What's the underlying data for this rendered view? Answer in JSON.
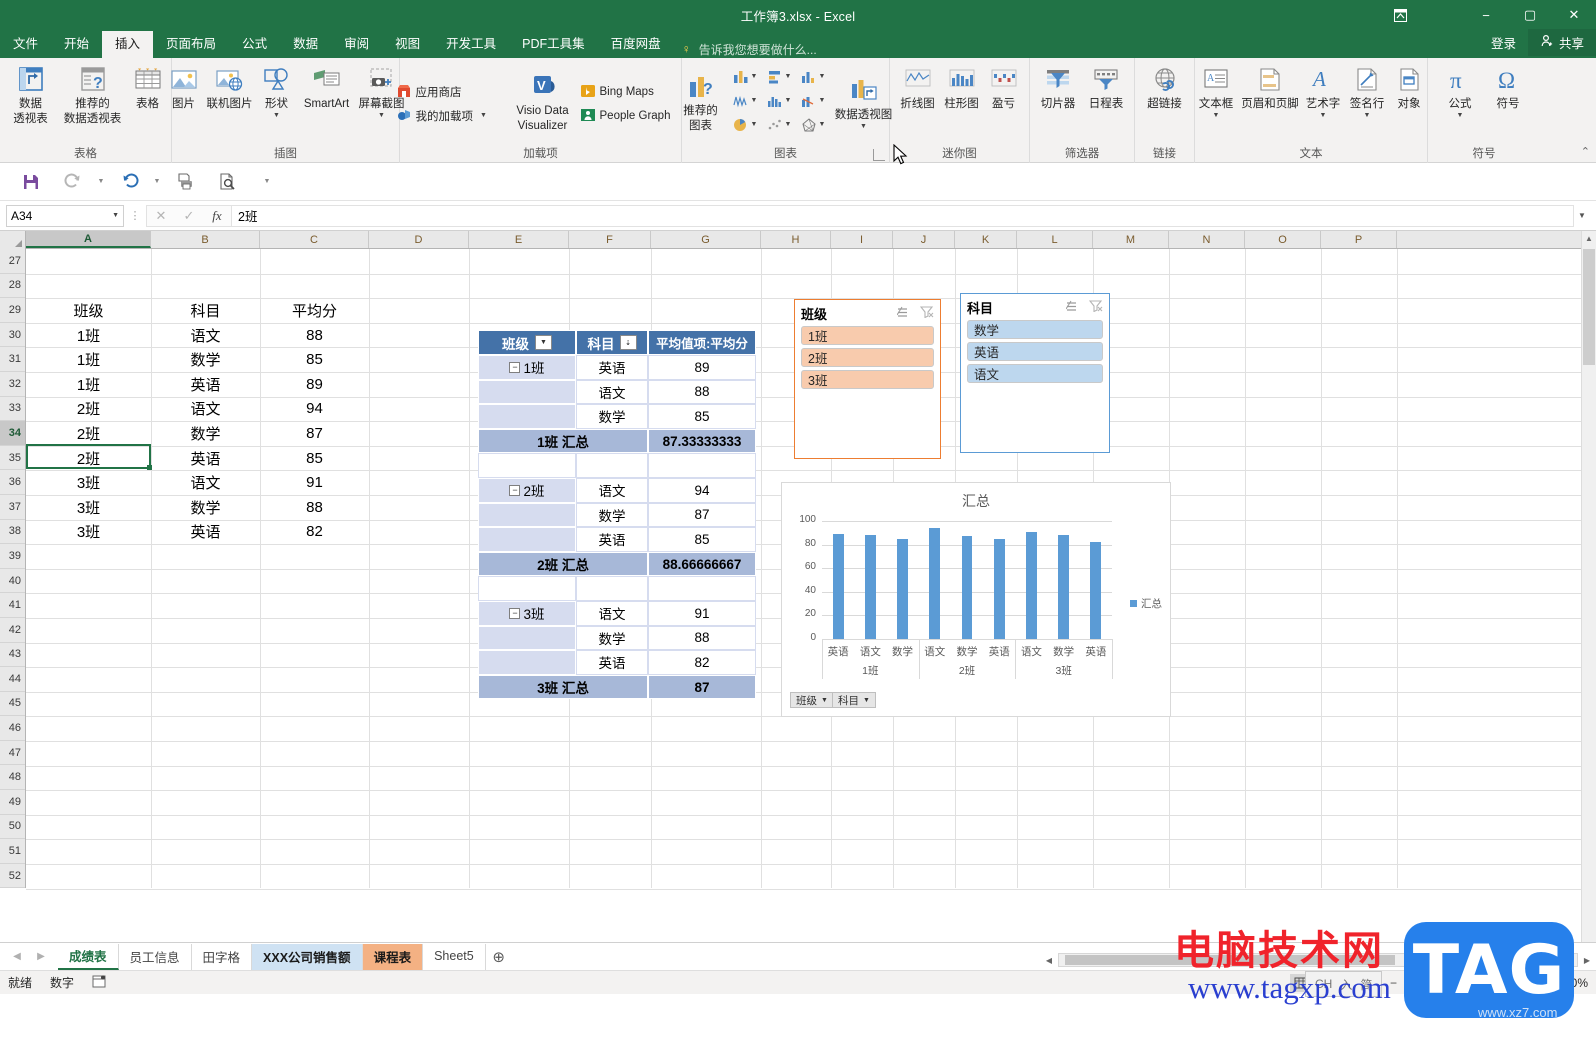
{
  "window": {
    "title": "工作簿3.xlsx - Excel",
    "ribbon_display_icon": "ribbon-display-options-icon",
    "minimize": "−",
    "maximize": "▢",
    "close": "✕",
    "signin": "登录",
    "share": "共享"
  },
  "ribbon_tabs": [
    {
      "label": "文件",
      "active": false
    },
    {
      "label": "开始",
      "active": false
    },
    {
      "label": "插入",
      "active": true
    },
    {
      "label": "页面布局",
      "active": false
    },
    {
      "label": "公式",
      "active": false
    },
    {
      "label": "数据",
      "active": false
    },
    {
      "label": "审阅",
      "active": false
    },
    {
      "label": "视图",
      "active": false
    },
    {
      "label": "开发工具",
      "active": false
    },
    {
      "label": "PDF工具集",
      "active": false
    },
    {
      "label": "百度网盘",
      "active": false
    }
  ],
  "tellme": "告诉我您想要做什么...",
  "ribbon": {
    "groups": [
      {
        "name": "表格",
        "big": [
          {
            "label1": "数据",
            "label2": "透视表",
            "icon": "pivot-table-icon",
            "caret": false
          },
          {
            "label1": "推荐的",
            "label2": "数据透视表",
            "icon": "recommended-pivot-icon",
            "caret": false
          },
          {
            "label1": "表格",
            "label2": "",
            "icon": "table-icon",
            "caret": false
          }
        ]
      },
      {
        "name": "插图",
        "big": [
          {
            "label1": "图片",
            "label2": "",
            "icon": "picture-icon",
            "caret": false
          },
          {
            "label1": "联机图片",
            "label2": "",
            "icon": "online-picture-icon",
            "caret": false
          },
          {
            "label1": "形状",
            "label2": "",
            "icon": "shapes-icon",
            "caret": true
          },
          {
            "label1": "SmartArt",
            "label2": "",
            "icon": "smartart-icon",
            "caret": false
          },
          {
            "label1": "屏幕截图",
            "label2": "",
            "icon": "screenshot-icon",
            "caret": true
          }
        ]
      },
      {
        "name": "加载项",
        "small": [
          {
            "label": "应用商店",
            "icon": "store-icon"
          },
          {
            "label": "我的加载项",
            "icon": "my-addins-icon",
            "caret": true
          }
        ],
        "big": [
          {
            "label1": "Visio Data",
            "label2": "Visualizer",
            "icon": "visio-icon"
          }
        ],
        "small2": [
          {
            "label": "Bing Maps",
            "icon": "bing-maps-icon"
          },
          {
            "label": "People Graph",
            "icon": "people-graph-icon"
          }
        ]
      },
      {
        "name": "图表",
        "big": [
          {
            "label1": "推荐的",
            "label2": "图表",
            "icon": "recommended-charts-icon"
          }
        ],
        "grid": [
          "column-chart-icon",
          "bar-chart-icon",
          "line-chart-icon",
          "waterfall-chart-icon",
          "histogram-icon",
          "combo-chart-icon",
          "pie-chart-icon",
          "scatter-chart-icon",
          "radar-chart-icon"
        ],
        "big2": [
          {
            "label1": "数据透视图",
            "label2": "",
            "icon": "pivot-chart-icon",
            "caret": true
          }
        ],
        "launcher": "dialog-box-launcher"
      },
      {
        "name": "迷你图",
        "big": [
          {
            "label1": "折线图",
            "label2": "",
            "icon": "sparkline-line-icon"
          },
          {
            "label1": "柱形图",
            "label2": "",
            "icon": "sparkline-column-icon"
          },
          {
            "label1": "盈亏",
            "label2": "",
            "icon": "sparkline-winloss-icon"
          }
        ]
      },
      {
        "name": "筛选器",
        "big": [
          {
            "label1": "切片器",
            "label2": "",
            "icon": "slicer-icon"
          },
          {
            "label1": "日程表",
            "label2": "",
            "icon": "timeline-icon"
          }
        ]
      },
      {
        "name": "链接",
        "big": [
          {
            "label1": "超链接",
            "label2": "",
            "icon": "hyperlink-icon"
          }
        ]
      },
      {
        "name": "文本",
        "big": [
          {
            "label1": "文本框",
            "label2": "",
            "icon": "text-box-icon",
            "caret": true
          },
          {
            "label1": "页眉和页脚",
            "label2": "",
            "icon": "header-footer-icon",
            "caret": false
          },
          {
            "label1": "艺术字",
            "label2": "",
            "icon": "wordart-icon",
            "caret": true
          },
          {
            "label1": "签名行",
            "label2": "",
            "icon": "signature-line-icon",
            "caret": true
          },
          {
            "label1": "对象",
            "label2": "",
            "icon": "object-icon",
            "caret": false
          }
        ]
      },
      {
        "name": "符号",
        "big": [
          {
            "label1": "公式",
            "label2": "",
            "icon": "equation-icon",
            "caret": true
          },
          {
            "label1": "符号",
            "label2": "",
            "icon": "symbol-icon",
            "caret": false
          }
        ]
      }
    ],
    "collapse": "⌃"
  },
  "qat": [
    {
      "name": "save-icon",
      "glyph": "save"
    },
    {
      "name": "redo-icon",
      "glyph": "redo"
    },
    {
      "name": "undo-icon",
      "glyph": "undo"
    },
    {
      "name": "quick-print-icon",
      "glyph": "print"
    },
    {
      "name": "print-preview-icon",
      "glyph": "preview"
    },
    {
      "name": "customize-qat-icon",
      "glyph": "caret"
    }
  ],
  "formula_bar": {
    "name_box": "A34",
    "cancel": "✕",
    "enter": "✓",
    "fx": "fx",
    "value": "2班"
  },
  "grid": {
    "columns": [
      "A",
      "B",
      "C",
      "D",
      "E",
      "F",
      "G",
      "H",
      "I",
      "J",
      "K",
      "L",
      "M",
      "N",
      "O",
      "P"
    ],
    "selected_column": "A",
    "rows": [
      27,
      28,
      29,
      30,
      31,
      32,
      33,
      34,
      35,
      36,
      37,
      38,
      39,
      40,
      41,
      42,
      43,
      44,
      45,
      46,
      47,
      48,
      49,
      50,
      51,
      52
    ],
    "selected_row": 34,
    "source_table": {
      "header": [
        "班级",
        "科目",
        "平均分"
      ],
      "header_row": 29,
      "rows": [
        {
          "row": 30,
          "班级": "1班",
          "科目": "语文",
          "平均分": "88"
        },
        {
          "row": 31,
          "班级": "1班",
          "科目": "数学",
          "平均分": "85"
        },
        {
          "row": 32,
          "班级": "1班",
          "科目": "英语",
          "平均分": "89"
        },
        {
          "row": 33,
          "班级": "2班",
          "科目": "语文",
          "平均分": "94"
        },
        {
          "row": 34,
          "班级": "2班",
          "科目": "数学",
          "平均分": "87"
        },
        {
          "row": 35,
          "班级": "2班",
          "科目": "英语",
          "平均分": "85"
        },
        {
          "row": 36,
          "班级": "3班",
          "科目": "语文",
          "平均分": "91"
        },
        {
          "row": 37,
          "班级": "3班",
          "科目": "数学",
          "平均分": "88"
        },
        {
          "row": 38,
          "班级": "3班",
          "科目": "英语",
          "平均分": "82"
        }
      ]
    }
  },
  "pivot": {
    "headers": [
      "班级",
      "科目",
      "平均值项:平均分"
    ],
    "rows": [
      {
        "type": "group",
        "班级": "1班",
        "科目": "英语",
        "值": "89"
      },
      {
        "type": "item",
        "班级": "",
        "科目": "语文",
        "值": "88"
      },
      {
        "type": "item",
        "班级": "",
        "科目": "数学",
        "值": "85"
      },
      {
        "type": "total",
        "label": "1班 汇总",
        "值": "87.33333333"
      },
      {
        "type": "blank",
        "label": "",
        "值": ""
      },
      {
        "type": "group",
        "班级": "2班",
        "科目": "语文",
        "值": "94"
      },
      {
        "type": "item",
        "班级": "",
        "科目": "数学",
        "值": "87"
      },
      {
        "type": "item",
        "班级": "",
        "科目": "英语",
        "值": "85"
      },
      {
        "type": "total",
        "label": "2班 汇总",
        "值": "88.66666667"
      },
      {
        "type": "blank",
        "label": "",
        "值": ""
      },
      {
        "type": "group",
        "班级": "3班",
        "科目": "语文",
        "值": "91"
      },
      {
        "type": "item",
        "班级": "",
        "科目": "数学",
        "值": "88"
      },
      {
        "type": "item",
        "班级": "",
        "科目": "英语",
        "值": "82"
      },
      {
        "type": "total",
        "label": "3班 汇总",
        "值": "87"
      }
    ]
  },
  "slicers": [
    {
      "title": "班级",
      "accent": "#ed7d31",
      "item_bg": "#f8cbad",
      "item_border": "#c9c9c9",
      "items": [
        "1班",
        "2班",
        "3班"
      ],
      "multiselect_icon": "multi-select-icon",
      "clearfilter_icon": "clear-filter-icon"
    },
    {
      "title": "科目",
      "accent": "#5b9bd5",
      "item_bg": "#bdd7ee",
      "item_border": "#c9c9c9",
      "items": [
        "数学",
        "英语",
        "语文"
      ],
      "multiselect_icon": "multi-select-icon",
      "clearfilter_icon": "clear-filter-icon"
    }
  ],
  "chart_data": {
    "type": "bar",
    "title": "汇总",
    "xlabel": "",
    "ylabel": "",
    "ylim": [
      0,
      100
    ],
    "yticks": [
      0,
      20,
      40,
      60,
      80,
      100
    ],
    "grid": true,
    "legend_position": "right",
    "series": [
      {
        "name": "汇总",
        "color": "#5b9bd5",
        "values": [
          89,
          88,
          85,
          94,
          87,
          85,
          91,
          88,
          82
        ]
      }
    ],
    "categories": [
      "英语",
      "语文",
      "数学",
      "语文",
      "数学",
      "英语",
      "语文",
      "数学",
      "英语"
    ],
    "groups": [
      {
        "label": "1班",
        "span": 3
      },
      {
        "label": "2班",
        "span": 3
      },
      {
        "label": "3班",
        "span": 3
      }
    ],
    "field_buttons": [
      "班级",
      "科目"
    ]
  },
  "sheet_tabs": [
    {
      "label": "成绩表",
      "state": "active"
    },
    {
      "label": "员工信息",
      "state": "normal"
    },
    {
      "label": "田字格",
      "state": "normal"
    },
    {
      "label": "XXX公司销售额",
      "state": "blue"
    },
    {
      "label": "课程表",
      "state": "orange"
    },
    {
      "label": "Sheet5",
      "state": "normal"
    }
  ],
  "add_sheet": "⊕",
  "status": {
    "ready": "就绪",
    "mode": "数字",
    "macro_icon": "record-macro-icon",
    "views": [
      "normal-view-icon",
      "page-layout-view-icon",
      "page-break-view-icon"
    ],
    "zoom_out": "−",
    "zoom_in": "+",
    "zoom_value": "80%"
  },
  "ime": {
    "lang": "CH",
    "mode1": "入",
    "mode2": "简"
  },
  "watermarks": {
    "red_text": "电脑技术网",
    "blue_text": "www.tagxp.com",
    "tag": "TAG",
    "xz7": "www.xz7.com"
  }
}
